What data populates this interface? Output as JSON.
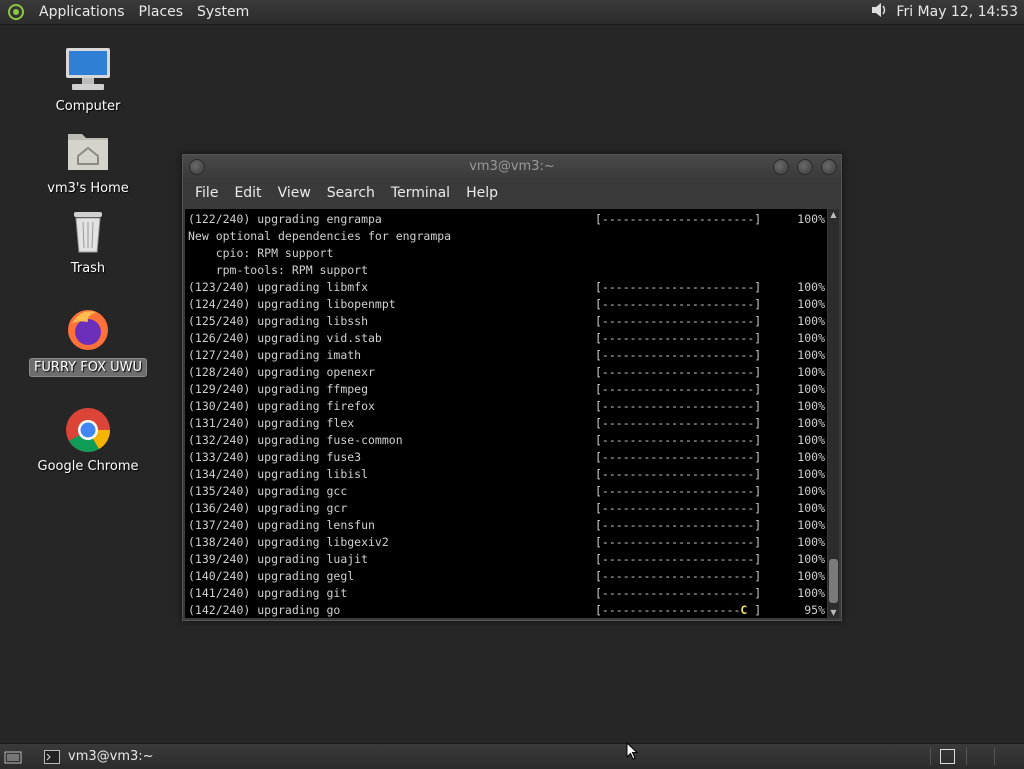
{
  "top_panel": {
    "menus": [
      "Applications",
      "Places",
      "System"
    ],
    "icons": {
      "logo": "distro-logo-icon",
      "volume": "speaker-icon"
    },
    "clock": "Fri May 12, 14:53"
  },
  "desktop_icons": [
    {
      "label": "Computer",
      "icon": "computer-icon"
    },
    {
      "label": "vm3's Home",
      "icon": "home-folder-icon"
    },
    {
      "label": "Trash",
      "icon": "trash-icon"
    },
    {
      "label": "FURRY FOX UWU",
      "icon": "firefox-icon"
    },
    {
      "label": "Google Chrome",
      "icon": "chrome-icon"
    }
  ],
  "terminal": {
    "title": "vm3@vm3:~",
    "menu": [
      "File",
      "Edit",
      "View",
      "Search",
      "Terminal",
      "Help"
    ],
    "lines": [
      {
        "text": "(122/240) upgrading engrampa",
        "bar": "[----------------------]",
        "pct": "100%"
      },
      {
        "text": "New optional dependencies for engrampa",
        "bar": "",
        "pct": ""
      },
      {
        "text": "    cpio: RPM support",
        "bar": "",
        "pct": ""
      },
      {
        "text": "    rpm-tools: RPM support",
        "bar": "",
        "pct": ""
      },
      {
        "text": "(123/240) upgrading libmfx",
        "bar": "[----------------------]",
        "pct": "100%"
      },
      {
        "text": "(124/240) upgrading libopenmpt",
        "bar": "[----------------------]",
        "pct": "100%"
      },
      {
        "text": "(125/240) upgrading libssh",
        "bar": "[----------------------]",
        "pct": "100%"
      },
      {
        "text": "(126/240) upgrading vid.stab",
        "bar": "[----------------------]",
        "pct": "100%"
      },
      {
        "text": "(127/240) upgrading imath",
        "bar": "[----------------------]",
        "pct": "100%"
      },
      {
        "text": "(128/240) upgrading openexr",
        "bar": "[----------------------]",
        "pct": "100%"
      },
      {
        "text": "(129/240) upgrading ffmpeg",
        "bar": "[----------------------]",
        "pct": "100%"
      },
      {
        "text": "(130/240) upgrading firefox",
        "bar": "[----------------------]",
        "pct": "100%"
      },
      {
        "text": "(131/240) upgrading flex",
        "bar": "[----------------------]",
        "pct": "100%"
      },
      {
        "text": "(132/240) upgrading fuse-common",
        "bar": "[----------------------]",
        "pct": "100%"
      },
      {
        "text": "(133/240) upgrading fuse3",
        "bar": "[----------------------]",
        "pct": "100%"
      },
      {
        "text": "(134/240) upgrading libisl",
        "bar": "[----------------------]",
        "pct": "100%"
      },
      {
        "text": "(135/240) upgrading gcc",
        "bar": "[----------------------]",
        "pct": "100%"
      },
      {
        "text": "(136/240) upgrading gcr",
        "bar": "[----------------------]",
        "pct": "100%"
      },
      {
        "text": "(137/240) upgrading lensfun",
        "bar": "[----------------------]",
        "pct": "100%"
      },
      {
        "text": "(138/240) upgrading libgexiv2",
        "bar": "[----------------------]",
        "pct": "100%"
      },
      {
        "text": "(139/240) upgrading luajit",
        "bar": "[----------------------]",
        "pct": "100%"
      },
      {
        "text": "(140/240) upgrading gegl",
        "bar": "[----------------------]",
        "pct": "100%"
      },
      {
        "text": "(141/240) upgrading git",
        "bar": "[----------------------]",
        "pct": "100%"
      },
      {
        "text": "(142/240) upgrading go",
        "bar": "[--------------------",
        "pac": "C",
        "bar_end": " ]",
        "pct": "95%"
      }
    ]
  },
  "bottom_panel": {
    "task_label": "vm3@vm3:~",
    "icons": {
      "show_desktop": "show-desktop-icon",
      "task": "terminal-icon",
      "workspace": "workspace-icon"
    }
  },
  "colors": {
    "desktop_bg": "#262626",
    "terminal_bg": "#000000",
    "pacman": "#f0e060"
  }
}
